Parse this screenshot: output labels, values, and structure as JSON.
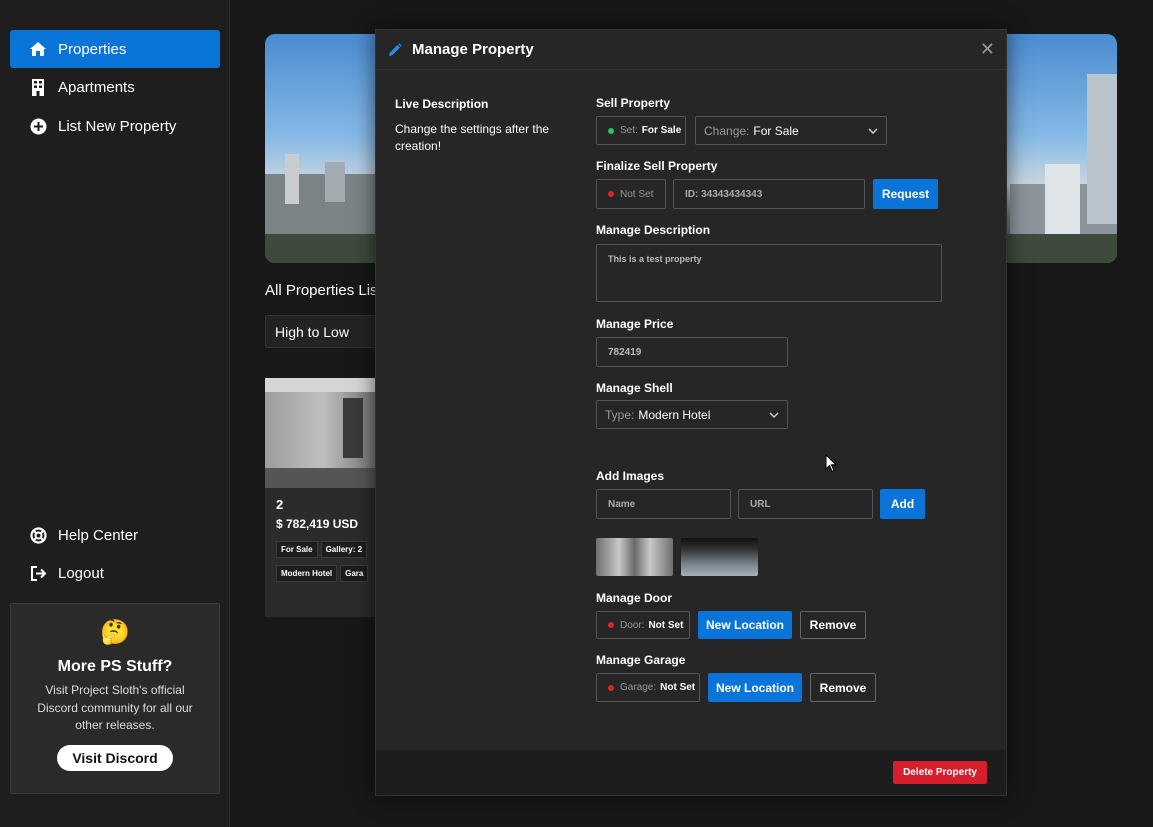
{
  "sidebar": {
    "items": [
      {
        "label": "Properties",
        "icon": "home-icon"
      },
      {
        "label": "Apartments",
        "icon": "building-icon"
      },
      {
        "label": "List New Property",
        "icon": "plus-circle-icon"
      }
    ],
    "bottom": [
      {
        "label": "Help Center",
        "icon": "lifebuoy-icon"
      },
      {
        "label": "Logout",
        "icon": "logout-icon"
      }
    ],
    "promo": {
      "emoji": "🤔",
      "title": "More PS Stuff?",
      "text": "Visit Project Sloth's official Discord community for all our other releases.",
      "button": "Visit Discord"
    }
  },
  "main": {
    "listed_title": "All Properties Liste",
    "sort_value": "High to Low",
    "card": {
      "number": "2",
      "price": "$ 782,419 USD",
      "chips": [
        "For Sale",
        "Gallery: 2",
        "Modern Hotel",
        "Gara"
      ]
    }
  },
  "modal": {
    "title": "Manage Property",
    "live_title": "Live Description",
    "live_text": "Change the settings after the creation!",
    "sell": {
      "label": "Sell Property",
      "set_prefix": "Set:",
      "set_value": "For Sale",
      "change_prefix": "Change:",
      "change_value": "For Sale"
    },
    "finalize": {
      "label": "Finalize Sell Property",
      "status": "Not Set",
      "id_placeholder": "ID: 34343434343",
      "button": "Request"
    },
    "description": {
      "label": "Manage Description",
      "value": "This is a test property"
    },
    "price": {
      "label": "Manage Price",
      "value": "782419"
    },
    "shell": {
      "label": "Manage Shell",
      "prefix": "Type:",
      "value": "Modern Hotel"
    },
    "images": {
      "label": "Add Images",
      "name_placeholder": "Name",
      "url_placeholder": "URL",
      "button": "Add"
    },
    "door": {
      "label": "Manage Door",
      "prefix": "Door:",
      "value": "Not Set",
      "new_button": "New Location",
      "remove_button": "Remove"
    },
    "garage": {
      "label": "Manage Garage",
      "prefix": "Garage:",
      "value": "Not Set",
      "new_button": "New Location",
      "remove_button": "Remove"
    },
    "delete_button": "Delete Property"
  },
  "colors": {
    "accent": "#0a74d8",
    "danger": "#d61f2c",
    "status_green": "#22c55e",
    "status_red": "#e02424"
  }
}
